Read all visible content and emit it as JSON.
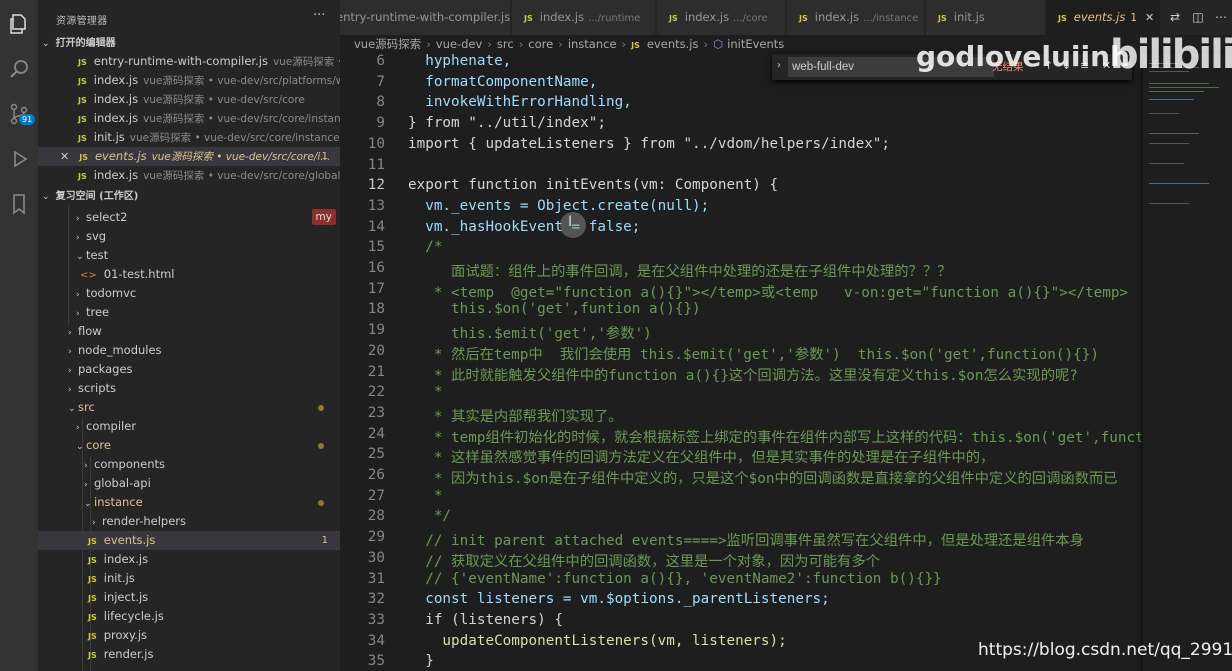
{
  "activity_bar": {
    "scm_badge": "91"
  },
  "sidebar": {
    "title": "资源管理器",
    "more": "···",
    "open_editors_title": "打开的编辑器",
    "open_editors": [
      {
        "name": "entry-runtime-with-compiler.js",
        "desc": "vue源码探索 • ..."
      },
      {
        "name": "index.js",
        "desc": "vue源码探索 • vue-dev/src/platforms/we..."
      },
      {
        "name": "index.js",
        "desc": "vue源码探索 • vue-dev/src/core"
      },
      {
        "name": "index.js",
        "desc": "vue源码探索 • vue-dev/src/core/instance"
      },
      {
        "name": "init.js",
        "desc": "vue源码探索 • vue-dev/src/core/instance"
      },
      {
        "name": "events.js",
        "desc": "vue源码探索 • vue-dev/src/core/i...",
        "count": "1",
        "close": "✕"
      },
      {
        "name": "index.js",
        "desc": "vue源码探索 • vue-dev/src/core/global-api"
      }
    ],
    "workspace_title": "复习空间 (工作区)",
    "tree": [
      {
        "name": "select2",
        "tag": "my"
      },
      {
        "name": "svg"
      },
      {
        "name": "test"
      },
      {
        "name": "01-test.html"
      },
      {
        "name": "todomvc"
      },
      {
        "name": "tree"
      },
      {
        "name": "flow"
      },
      {
        "name": "node_modules"
      },
      {
        "name": "packages"
      },
      {
        "name": "scripts"
      },
      {
        "name": "src"
      },
      {
        "name": "compiler"
      },
      {
        "name": "core"
      },
      {
        "name": "components"
      },
      {
        "name": "global-api"
      },
      {
        "name": "instance"
      },
      {
        "name": "render-helpers"
      },
      {
        "name": "events.js",
        "count": "1"
      },
      {
        "name": "index.js"
      },
      {
        "name": "init.js"
      },
      {
        "name": "inject.js"
      },
      {
        "name": "lifecycle.js"
      },
      {
        "name": "proxy.js"
      },
      {
        "name": "render.js"
      }
    ]
  },
  "tabs": [
    {
      "name": "entry-runtime-with-compiler.js",
      "desc": ""
    },
    {
      "name": "index.js",
      "desc": ".../runtime"
    },
    {
      "name": "index.js",
      "desc": ".../core"
    },
    {
      "name": "index.js",
      "desc": ".../instance"
    },
    {
      "name": "init.js",
      "desc": ""
    },
    {
      "name": "events.js",
      "desc": "",
      "count": "1",
      "close": "✕"
    }
  ],
  "breadcrumb": [
    "vue源码探索",
    "vue-dev",
    "src",
    "core",
    "instance",
    "events.js",
    "initEvents"
  ],
  "find_widget": {
    "value": "web-full-dev",
    "result": "无结果"
  },
  "editor": {
    "line_numbers": [
      "6",
      "7",
      "8",
      "9",
      "10",
      "11",
      "12",
      "13",
      "14",
      "15",
      "16",
      "17",
      "18",
      "19",
      "20",
      "21",
      "22",
      "23",
      "24",
      "25",
      "26",
      "27",
      "28",
      "29",
      "30",
      "31",
      "32",
      "33",
      "34",
      "35"
    ],
    "lines": [
      "  hyphenate,",
      "  formatComponentName,",
      "  invokeWithErrorHandling,",
      "} from \"../util/index\";",
      "import { updateListeners } from \"../vdom/helpers/index\";",
      "",
      "export function initEvents(vm: Component) {",
      "  vm._events = Object.create(null);",
      "  vm._hasHookEvent = false;",
      "  /*",
      "     面试题：组件上的事件回调，是在父组件中处理的还是在子组件中处理的？？？",
      "   * <temp  @get=\"function a(){}\"></temp>或<temp   v-on:get=\"function a(){}\"></temp>",
      "     this.$on('get',funtion a(){})",
      "     this.$emit('get','参数')",
      "   * 然后在temp中  我们会使用 this.$emit('get','参数')  this.$on('get',function(){})",
      "   * 此时就能触发父组件中的function a(){}这个回调方法。这里没有定义this.$on怎么实现的呢?",
      "   *",
      "   * 其实是内部帮我们实现了。",
      "   * temp组件初始化的时候，就会根据标签上绑定的事件在组件内部写上这样的代码：this.$on('get',function",
      "   * 这样虽然感觉事件的回调方法定义在父组件中，但是其实事件的处理是在子组件中的，",
      "   * 因为this.$on是在子组件中定义的，只是这个$on中的回调函数是直接拿的父组件中定义的回调函数而已",
      "   *",
      "   */",
      "  // init parent attached events====>监听回调事件虽然写在父组件中，但是处理还是组件本身",
      "  // 获取定义在父组件中的回调函数，这里是一个对象，因为可能有多个",
      "  // {'eventName':function a(){}, 'eventName2':function b(){}}",
      "  const listeners = vm.$options._parentListeners;",
      "  if (listeners) {",
      "    updateComponentListeners(vm, listeners);",
      "  }"
    ]
  },
  "watermark": {
    "user": "godloveluiinh",
    "logo": "bilibili",
    "url": "https://blog.csdn.net/qq_29918313"
  }
}
